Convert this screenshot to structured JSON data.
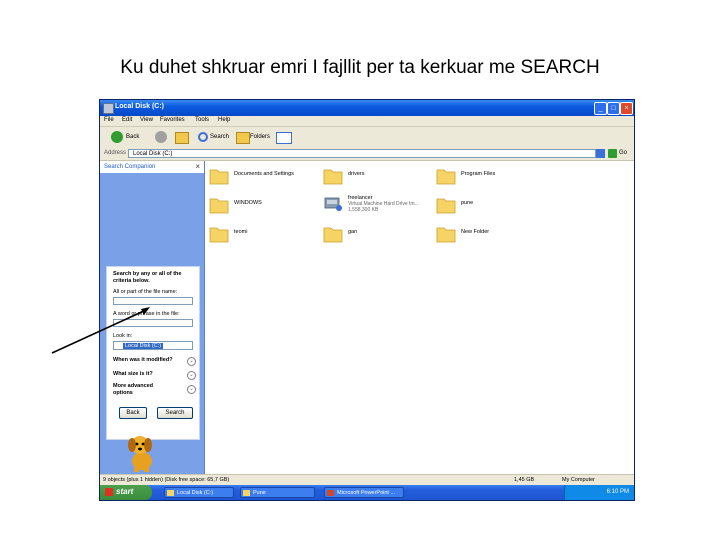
{
  "slide": {
    "title": "Ku duhet shkruar emri I fajllit per ta kerkuar me SEARCH"
  },
  "window": {
    "title": "Local Disk (C:)",
    "menu": [
      "File",
      "Edit",
      "View",
      "Favorites",
      "Tools",
      "Help"
    ],
    "toolbar": {
      "back": "Back",
      "search": "Search",
      "folders": "Folders"
    },
    "address": {
      "label": "Address",
      "value": "Local Disk (C:)",
      "go": "Go"
    }
  },
  "search_pane": {
    "title": "Search Companion",
    "heading": "Search by any or all of the criteria below.",
    "name_label": "All or part of the file name:",
    "name_value": "",
    "phrase_label": "A word or phrase in the file:",
    "phrase_value": "",
    "lookin_label": "Look in:",
    "lookin_value": "Local Disk (C:)",
    "options": [
      "When was it modified?",
      "What size is it?",
      "More advanced options"
    ],
    "back_button": "Back",
    "search_button": "Search"
  },
  "files": [
    {
      "name": "Documents and Settings",
      "icon": "folder-icon"
    },
    {
      "name": "drivers",
      "icon": "folder-icon"
    },
    {
      "name": "Program Files",
      "icon": "folder-icon"
    },
    {
      "name": "WINDOWS",
      "icon": "folder-icon"
    },
    {
      "name": "freelancer",
      "sub": "Virtual Machine Hard Drive Im...",
      "sub2": "1,558,300 KB",
      "icon": "vm-disk-icon"
    },
    {
      "name": "pune",
      "icon": "folder-icon"
    },
    {
      "name": "teomi",
      "icon": "folder-icon"
    },
    {
      "name": "gan",
      "icon": "folder-icon"
    },
    {
      "name": "New Folder",
      "icon": "folder-icon"
    }
  ],
  "status": {
    "left": "9 objects (plus 1 hidden) (Disk free space: 65,7 GB)",
    "size": "1,45 GB",
    "location": "My Computer"
  },
  "taskbar": {
    "start": "start",
    "tasks": [
      "Local Disk (C:)",
      "Pune",
      "Microsoft PowerPoint ..."
    ],
    "clock": "6:10 PM"
  },
  "colors": {
    "titlebar": "#0a5ae0",
    "search_pane": "#7aa0e8",
    "taskbar": "#245edb",
    "start": "#3a8c3a"
  }
}
